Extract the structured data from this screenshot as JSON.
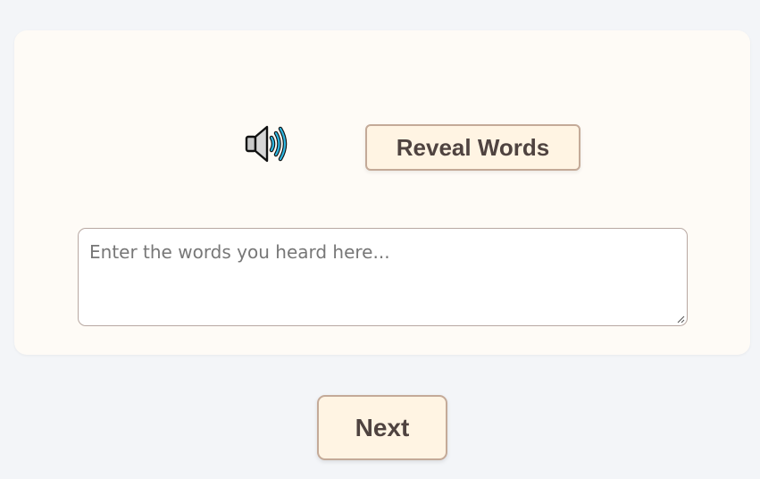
{
  "card": {
    "speaker": {
      "icon": "speaker-with-sound-waves-icon"
    },
    "reveal_button": {
      "label": "Reveal Words"
    },
    "answer_input": {
      "value": "",
      "placeholder": "Enter the words you heard here..."
    }
  },
  "footer": {
    "next_button": {
      "label": "Next"
    }
  },
  "colors": {
    "page_background": "#f3f5f8",
    "card_background": "#fefbf6",
    "button_background": "#fff4e3",
    "button_border": "#c4aa98",
    "button_text": "#4f4340",
    "speaker_wave": "#2fb6e0"
  }
}
